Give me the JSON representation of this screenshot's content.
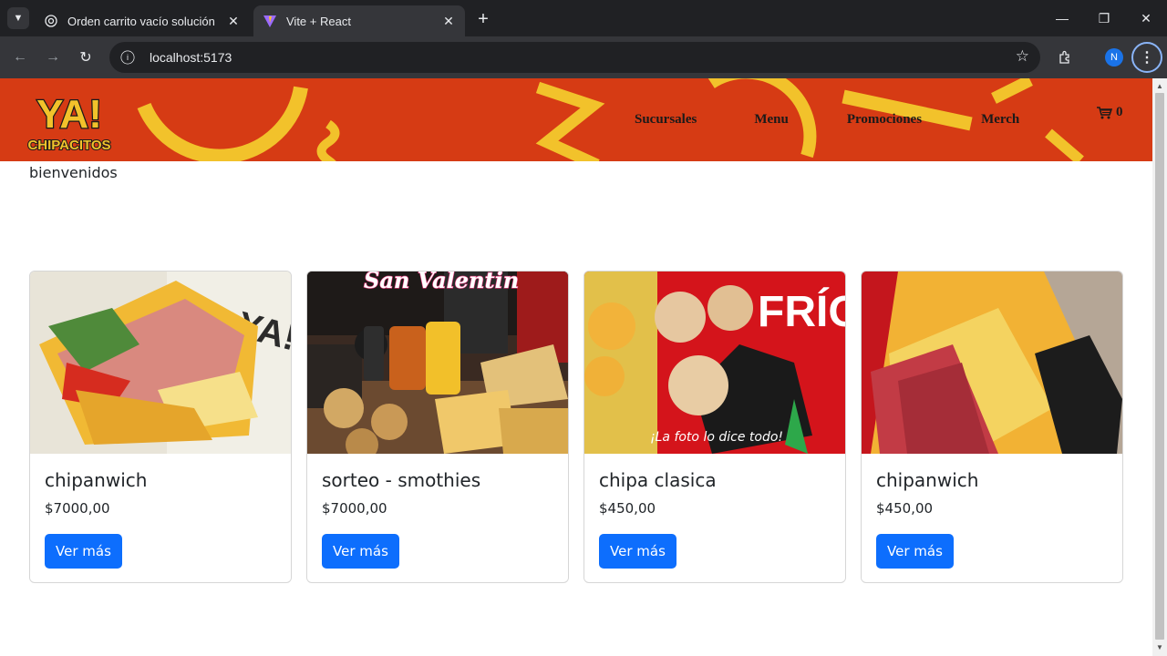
{
  "browser": {
    "tabs": [
      {
        "title": "Orden carrito vacío solución",
        "active": false
      },
      {
        "title": "Vite + React",
        "active": true
      }
    ],
    "url": "localhost:5173",
    "profile_initial": "N"
  },
  "site": {
    "logo_top": "YA!",
    "logo_bottom": "CHIPACITOS",
    "nav": [
      "Sucursales",
      "Menu",
      "Promociones",
      "Merch"
    ],
    "cart_count": "0",
    "welcome": "bienvenidos",
    "colors": {
      "header": "#d63b14",
      "accent": "#f2c22b",
      "button": "#0d6efd"
    }
  },
  "products": [
    {
      "name": "chipanwich",
      "price": "$7000,00",
      "button": "Ver más",
      "image": "sandwich-ham-lettuce"
    },
    {
      "name": "sorteo - smothies",
      "price": "$7000,00",
      "button": "Ver más",
      "image": "san-valentin-spread",
      "image_text": "San Valentin"
    },
    {
      "name": "chipa clasica",
      "price": "$450,00",
      "button": "Ver más",
      "image": "chipa-balls-glove",
      "image_text": "¡La foto lo dice todo!"
    },
    {
      "name": "chipanwich",
      "price": "$450,00",
      "button": "Ver más",
      "image": "sandwich-salami-cheese"
    }
  ]
}
